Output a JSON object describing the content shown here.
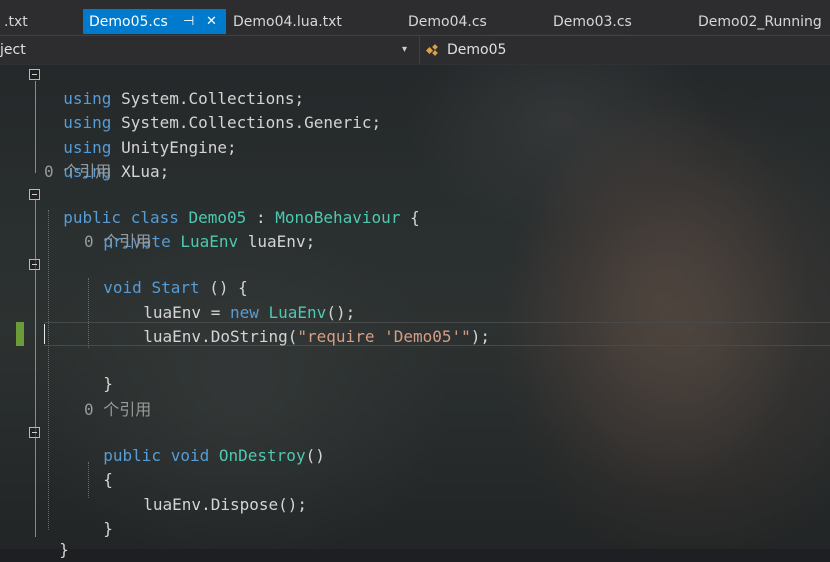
{
  "tabs": [
    {
      "label": ".txt",
      "active": false
    },
    {
      "label": "Demo05.cs",
      "active": true,
      "pin_glyph": "⊣",
      "close_glyph": "✕"
    },
    {
      "label": "Demo04.lua.txt",
      "active": false
    },
    {
      "label": "Demo04.cs",
      "active": false
    },
    {
      "label": "Demo03.cs",
      "active": false
    },
    {
      "label": "Demo02_Running",
      "active": false
    }
  ],
  "navbar": {
    "left_text": "ject",
    "caret": "▾",
    "class_name": "Demo05",
    "class_icon": "class-icon"
  },
  "code": {
    "l1": {
      "kw": "using",
      "rest": " System.Collections;"
    },
    "l2": {
      "kw": "using",
      "rest": " System.Collections.Generic;"
    },
    "l3": {
      "kw": "using",
      "rest": " UnityEngine;"
    },
    "l4": {
      "kw": "using",
      "rest": " XLua;"
    },
    "ref1": "0 个引用",
    "l5": {
      "kw1": "public",
      "kw2": "class",
      "type": "Demo05",
      "colon": " : ",
      "base": "MonoBehaviour",
      "brace": " {"
    },
    "l6": {
      "kw": "private",
      "type": "LuaEnv",
      "rest": " luaEnv;"
    },
    "ref2": "0 个引用",
    "l7": {
      "kw": "void",
      "name": "Start",
      "rest": " () {"
    },
    "l8": {
      "lhs": "luaEnv = ",
      "kw": "new",
      "type": "LuaEnv",
      "rest": "();"
    },
    "l9": {
      "pre": "luaEnv.DoString(",
      "str": "\"require 'Demo05'\"",
      "post": ");"
    },
    "l11": {
      "text": "}"
    },
    "ref3": "0 个引用",
    "l12": {
      "kw1": "public",
      "kw2": "void",
      "name": "OnDestroy",
      "rest": "()"
    },
    "l13": {
      "text": "{"
    },
    "l14": {
      "text": "luaEnv.Dispose();"
    },
    "l15": {
      "text": "}"
    },
    "l16": {
      "text": "}"
    }
  },
  "colors": {
    "keyword": "#569cd6",
    "type": "#4ec9b0",
    "string": "#d69d85",
    "text": "#d4d4d4",
    "active_tab": "#007acc",
    "change_bar": "#6c9c3a"
  }
}
